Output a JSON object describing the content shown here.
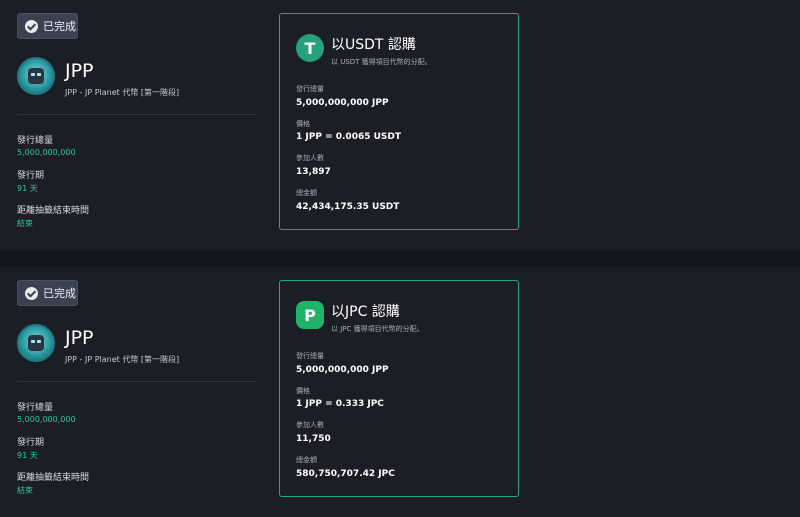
{
  "campaigns": [
    {
      "status": "已完成",
      "token_name": "JPP",
      "token_sub": "JPP - JP Planet 代幣 [第一階段]",
      "stats": [
        {
          "label": "發行總量",
          "value": "5,000,000,000"
        },
        {
          "label": "發行期",
          "value": "91 天"
        },
        {
          "label": "距離抽籤結束時間",
          "value": "結束"
        }
      ],
      "card": {
        "coin_icon": "tether-icon",
        "coin_glyph": "T",
        "title": "以USDT 認購",
        "desc": "以 USDT 獲得項目代幣的分配。",
        "rows": [
          {
            "label": "發行總量",
            "value": "5,000,000,000 JPP"
          },
          {
            "label": "價格",
            "value": "1 JPP = 0.0065 USDT"
          },
          {
            "label": "參加人數",
            "value": "13,897"
          },
          {
            "label": "總金額",
            "value": "42,434,175.35 USDT"
          }
        ]
      }
    },
    {
      "status": "已完成",
      "token_name": "JPP",
      "token_sub": "JPP - JP Planet 代幣 [第一階段]",
      "stats": [
        {
          "label": "發行總量",
          "value": "5,000,000,000"
        },
        {
          "label": "發行期",
          "value": "91 天"
        },
        {
          "label": "距離抽籤結束時間",
          "value": "結束"
        }
      ],
      "card": {
        "coin_icon": "jpc-icon",
        "coin_glyph": "P",
        "title": "以JPC 認購",
        "desc": "以 JPC 獲得項目代幣的分配。",
        "rows": [
          {
            "label": "發行總量",
            "value": "5,000,000,000 JPP"
          },
          {
            "label": "價格",
            "value": "1 JPP = 0.333 JPC"
          },
          {
            "label": "參加人數",
            "value": "11,750"
          },
          {
            "label": "總金額",
            "value": "580,750,707.42 JPC"
          }
        ]
      }
    }
  ],
  "colors": {
    "accent": "#2fc4a4",
    "card_border": "#27a58b",
    "panel_bg": "#1b1f25",
    "page_bg": "#13161b"
  }
}
